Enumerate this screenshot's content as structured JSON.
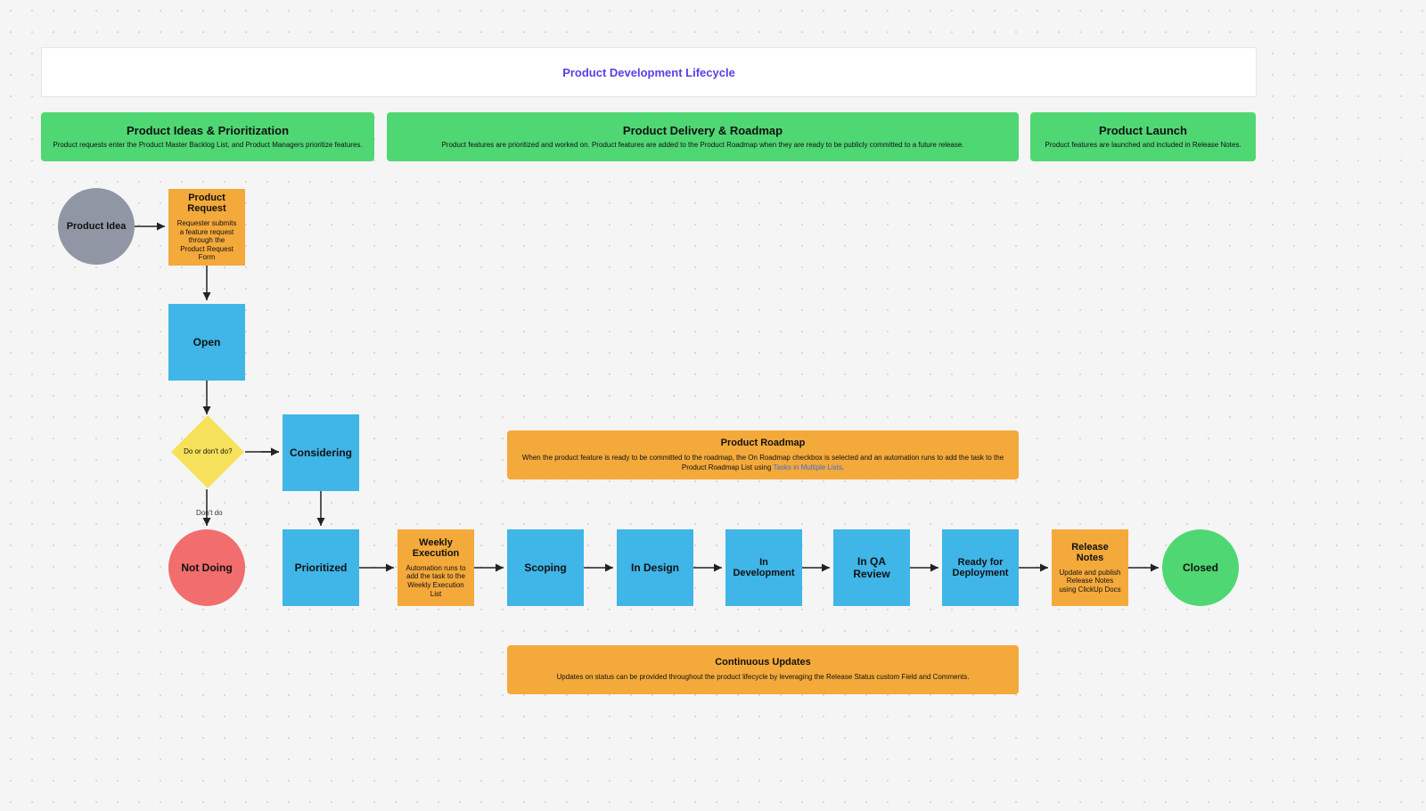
{
  "title": "Product Development Lifecycle",
  "phases": {
    "ideas": {
      "title": "Product Ideas & Prioritization",
      "desc": "Product requests enter the Product Master Backlog List, and Product Managers prioritize features."
    },
    "delivery": {
      "title": "Product Delivery & Roadmap",
      "desc": "Product features are prioritized and worked on. Product features are added to the Product Roadmap when they are ready to be publicly committed to a future release."
    },
    "launch": {
      "title": "Product Launch",
      "desc": "Product features are launched and included in Release Notes."
    }
  },
  "product_idea": "Product Idea",
  "product_request": {
    "title": "Product Request",
    "desc": "Requester submits a feature request through the Product Request Form"
  },
  "open": "Open",
  "decision": "Do or don't do?",
  "decision_no": "Don't do",
  "not_doing": "Not Doing",
  "considering": "Considering",
  "prioritized": "Prioritized",
  "weekly": {
    "title": "Weekly Execution",
    "desc": "Automation runs to add the task to the Weekly Execution List"
  },
  "scoping": "Scoping",
  "in_design": "In Design",
  "in_dev": "In Development",
  "in_qa": "In QA Review",
  "ready_deploy": "Ready for Deployment",
  "release_notes": {
    "title": "Release Notes",
    "desc": "Update and publish Release Notes using ClickUp Docs"
  },
  "closed": "Closed",
  "roadmap": {
    "title": "Product Roadmap",
    "desc_a": "When the product feature is ready to be committed to the roadmap, the On Roadmap checkbox is selected and an automation runs to add the task to the Product Roadmap List using ",
    "desc_link": "Tasks in Multiple Lists",
    "desc_b": "."
  },
  "continuous": {
    "title": "Continuous Updates",
    "desc": "Updates on status can be provided throughout the product lifecycle by leveraging the Release Status custom Field and Comments."
  }
}
